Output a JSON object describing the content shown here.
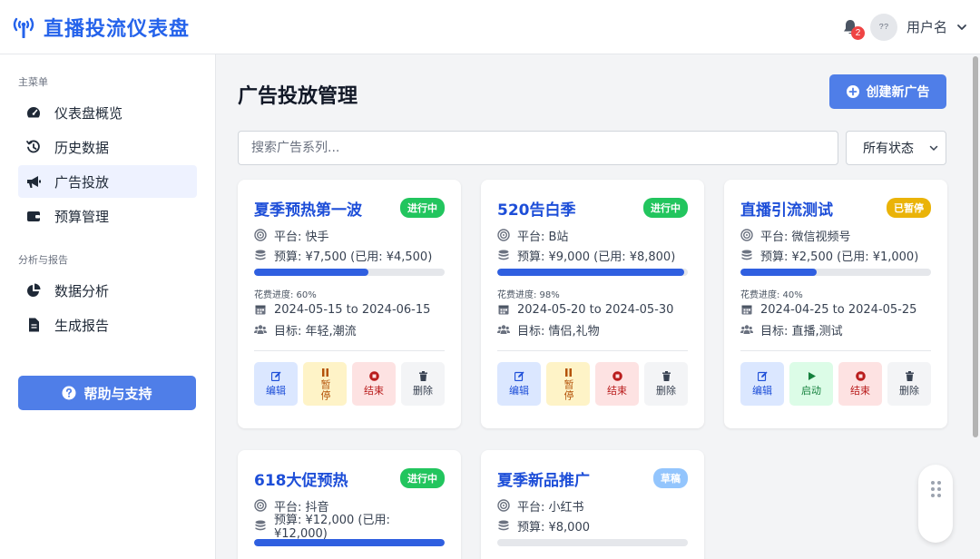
{
  "header": {
    "title": "直播投流仪表盘",
    "notification_count": "2",
    "avatar_text": "??",
    "username": "用户名"
  },
  "sidebar": {
    "group_main": "主菜单",
    "group_analysis": "分析与报告",
    "items": [
      {
        "label": "仪表盘概览",
        "icon": "gauge-icon"
      },
      {
        "label": "历史数据",
        "icon": "history-icon"
      },
      {
        "label": "广告投放",
        "icon": "megaphone-icon",
        "active": true
      },
      {
        "label": "预算管理",
        "icon": "wallet-icon"
      },
      {
        "label": "数据分析",
        "icon": "pie-chart-icon"
      },
      {
        "label": "生成报告",
        "icon": "file-icon"
      }
    ],
    "help_label": "帮助与支持"
  },
  "main": {
    "title": "广告投放管理",
    "create_label": "创建新广告",
    "search_placeholder": "搜索广告系列...",
    "status_filter": "所有状态"
  },
  "colors": {
    "accent": "#4f7ee8",
    "status_running": "#22c55e",
    "status_paused": "#eab308",
    "status_draft": "#93c5fd"
  },
  "campaigns": [
    {
      "name": "夏季预热第一波",
      "status": "进行中",
      "platform": "平台: 快手",
      "budget": "预算: ¥7,500 (已用: ¥4,500)",
      "spend_percent": 60,
      "spend_label": "花费进度: 60%",
      "dates": "2024-05-15 to 2024-06-15",
      "target": "目标: 年轻,潮流",
      "actions": [
        "编辑",
        "暂停",
        "结束",
        "删除"
      ]
    },
    {
      "name": "520告白季",
      "status": "进行中",
      "platform": "平台: B站",
      "budget": "预算: ¥9,000 (已用: ¥8,800)",
      "spend_percent": 98,
      "spend_label": "花费进度: 98%",
      "dates": "2024-05-20 to 2024-05-30",
      "target": "目标: 情侣,礼物",
      "actions": [
        "编辑",
        "暂停",
        "结束",
        "删除"
      ]
    },
    {
      "name": "直播引流测试",
      "status": "已暂停",
      "platform": "平台: 微信视频号",
      "budget": "预算: ¥2,500 (已用: ¥1,000)",
      "spend_percent": 40,
      "spend_label": "花费进度: 40%",
      "dates": "2024-04-25 to 2024-05-25",
      "target": "目标: 直播,测试",
      "actions": [
        "编辑",
        "启动",
        "结束",
        "删除"
      ]
    },
    {
      "name": "618大促预热",
      "status": "进行中",
      "platform": "平台: 抖音",
      "budget": "预算: ¥12,000 (已用: ¥12,000)",
      "spend_percent": 100
    },
    {
      "name": "夏季新品推广",
      "status": "草稿",
      "platform": "平台: 小红书",
      "budget": "预算: ¥8,000",
      "spend_percent": 0
    }
  ]
}
